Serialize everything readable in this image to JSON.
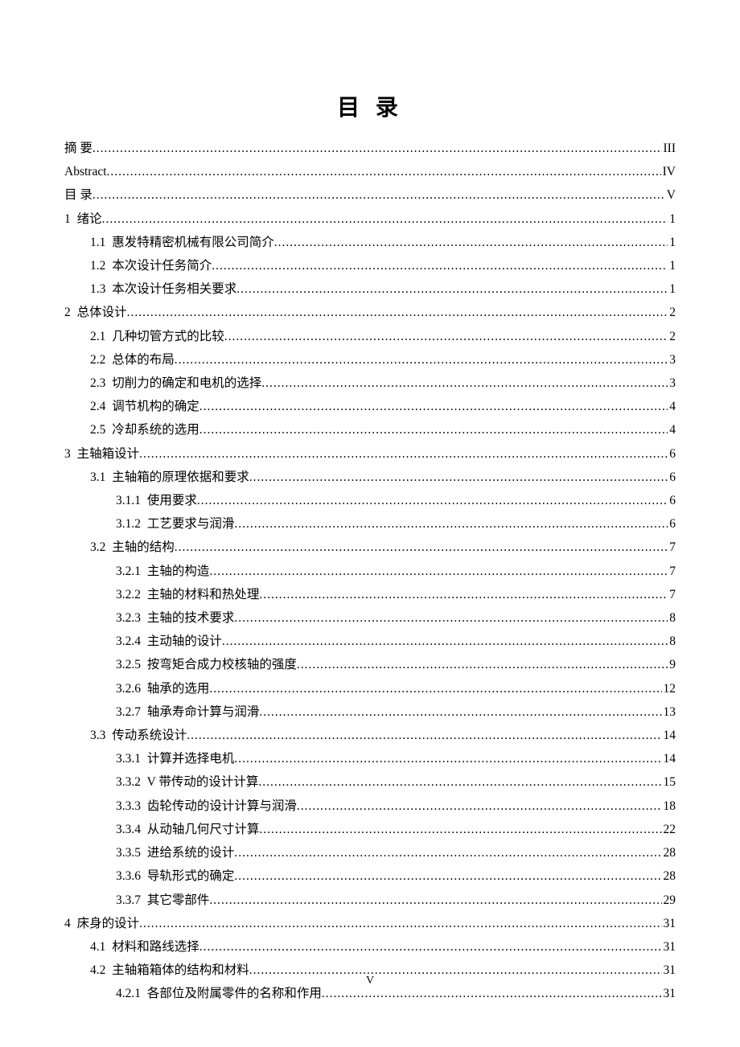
{
  "title": "目 录",
  "footer": "V",
  "toc": [
    {
      "level": 0,
      "label": "摘 要",
      "page": "III"
    },
    {
      "level": 0,
      "label": "Abstract",
      "page": "IV",
      "roman_label": true
    },
    {
      "level": 0,
      "label": "目 录",
      "page": "V"
    },
    {
      "level": 0,
      "num": "1",
      "label": "绪论",
      "page": "1"
    },
    {
      "level": 1,
      "num": "1.1",
      "label": "惠发特精密机械有限公司简介",
      "page": "1"
    },
    {
      "level": 1,
      "num": "1.2",
      "label": "本次设计任务简介",
      "page": "1"
    },
    {
      "level": 1,
      "num": "1.3",
      "label": "本次设计任务相关要求",
      "page": "1"
    },
    {
      "level": 0,
      "num": "2",
      "label": "总体设计",
      "page": "2"
    },
    {
      "level": 1,
      "num": "2.1",
      "label": "几种切管方式的比较",
      "page": "2"
    },
    {
      "level": 1,
      "num": "2.2",
      "label": "总体的布局",
      "page": "3"
    },
    {
      "level": 1,
      "num": "2.3",
      "label": "切削力的确定和电机的选择",
      "page": "3"
    },
    {
      "level": 1,
      "num": "2.4",
      "label": "调节机构的确定",
      "page": "4"
    },
    {
      "level": 1,
      "num": "2.5",
      "label": "冷却系统的选用",
      "page": "4"
    },
    {
      "level": 0,
      "num": "3",
      "label": "主轴箱设计",
      "page": "6"
    },
    {
      "level": 1,
      "num": "3.1",
      "label": "主轴箱的原理依据和要求",
      "page": "6"
    },
    {
      "level": 2,
      "num": "3.1.1",
      "label": "使用要求",
      "page": "6"
    },
    {
      "level": 2,
      "num": "3.1.2",
      "label": "工艺要求与润滑",
      "page": "6"
    },
    {
      "level": 1,
      "num": "3.2",
      "label": "主轴的结构",
      "page": "7"
    },
    {
      "level": 2,
      "num": "3.2.1",
      "label": "主轴的构造",
      "page": "7"
    },
    {
      "level": 2,
      "num": "3.2.2",
      "label": "主轴的材料和热处理",
      "page": "7"
    },
    {
      "level": 2,
      "num": "3.2.3",
      "label": "主轴的技术要求",
      "page": "8"
    },
    {
      "level": 2,
      "num": "3.2.4",
      "label": "主动轴的设计",
      "page": "8"
    },
    {
      "level": 2,
      "num": "3.2.5",
      "label": "按弯矩合成力校核轴的强度",
      "page": "9"
    },
    {
      "level": 2,
      "num": "3.2.6",
      "label": "轴承的选用",
      "page": "12"
    },
    {
      "level": 2,
      "num": "3.2.7",
      "label": "轴承寿命计算与润滑",
      "page": "13"
    },
    {
      "level": 1,
      "num": "3.3",
      "label": "传动系统设计",
      "page": "14"
    },
    {
      "level": 2,
      "num": "3.3.1",
      "label": "计算并选择电机",
      "page": "14"
    },
    {
      "level": 2,
      "num": "3.3.2",
      "label": "V 带传动的设计计算",
      "page": "15",
      "mixed_num": true
    },
    {
      "level": 2,
      "num": "3.3.3",
      "label": "齿轮传动的设计计算与润滑",
      "page": "18"
    },
    {
      "level": 2,
      "num": "3.3.4",
      "label": "从动轴几何尺寸计算",
      "page": "22"
    },
    {
      "level": 2,
      "num": "3.3.5",
      "label": "进给系统的设计",
      "page": "28"
    },
    {
      "level": 2,
      "num": "3.3.6",
      "label": "导轨形式的确定",
      "page": "28"
    },
    {
      "level": 2,
      "num": "3.3.7",
      "label": "其它零部件",
      "page": "29"
    },
    {
      "level": 0,
      "num": "4",
      "label": "床身的设计",
      "page": "31"
    },
    {
      "level": 1,
      "num": "4.1",
      "label": "材料和路线选择",
      "page": "31"
    },
    {
      "level": 1,
      "num": "4.2",
      "label": "主轴箱箱体的结构和材料",
      "page": "31"
    },
    {
      "level": 2,
      "num": "4.2.1",
      "label": "各部位及附属零件的名称和作用",
      "page": "31"
    }
  ]
}
